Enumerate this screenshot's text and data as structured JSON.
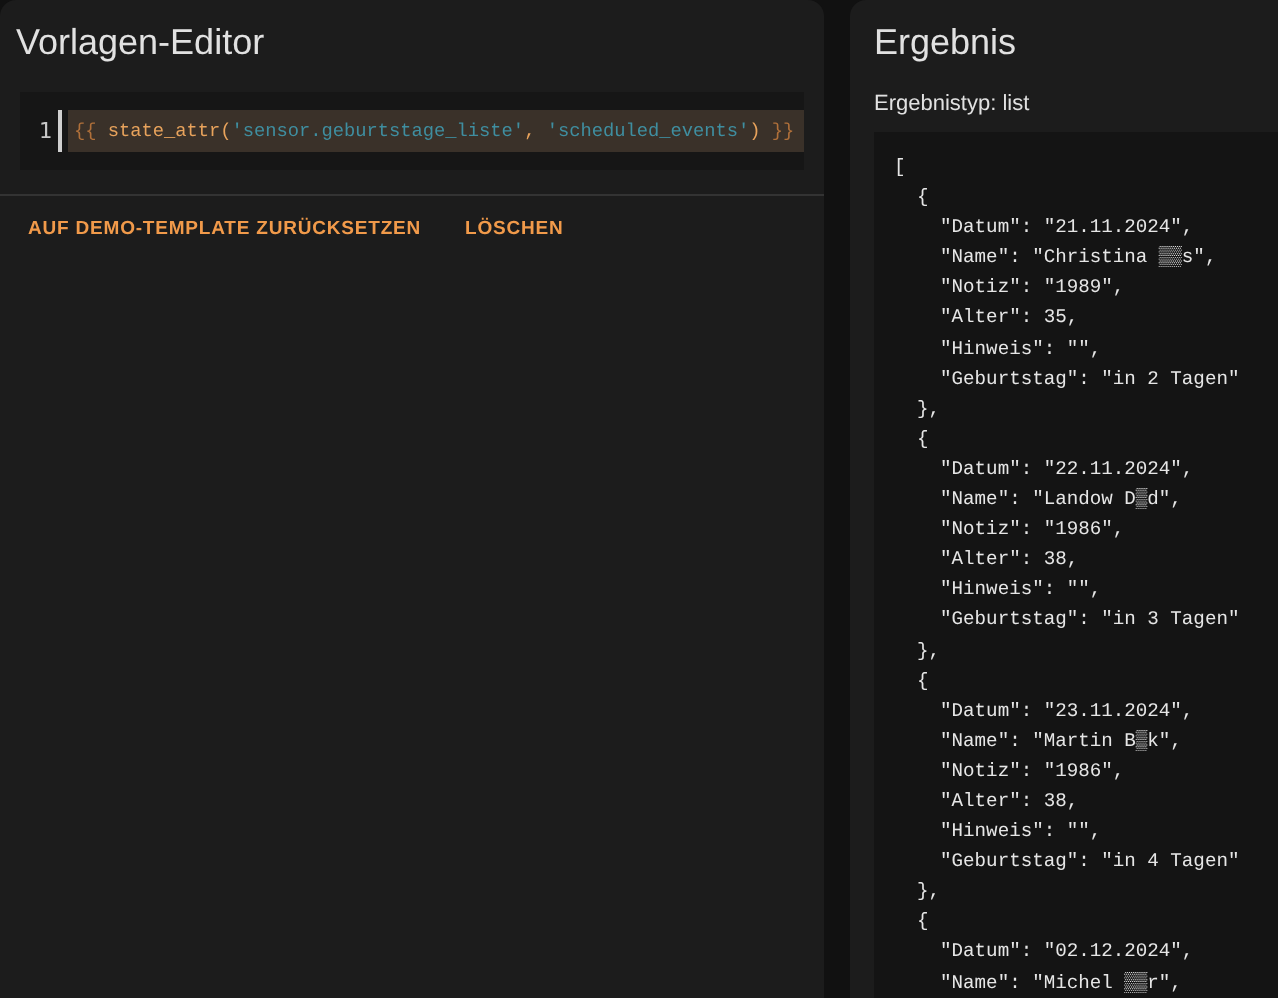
{
  "editor": {
    "title": "Vorlagen-Editor",
    "line_number": "1",
    "code_tokens": [
      {
        "kind": "brace",
        "text": "{{ "
      },
      {
        "kind": "func",
        "text": "state_attr("
      },
      {
        "kind": "string",
        "text": "'sensor.geburtstage_liste'"
      },
      {
        "kind": "func",
        "text": ", "
      },
      {
        "kind": "string",
        "text": "'scheduled_events'"
      },
      {
        "kind": "func",
        "text": ") "
      },
      {
        "kind": "brace",
        "text": "}}"
      }
    ],
    "buttons": [
      "AUF DEMO-TEMPLATE ZURÜCKSETZEN",
      "LÖSCHEN"
    ]
  },
  "result": {
    "title": "Ergebnis",
    "type_label": "Ergebnistyp: list",
    "lines": [
      "[",
      "  {",
      "    \"Datum\": \"21.11.2024\",",
      "    \"Name\": \"Christina ▒▒s\",",
      "    \"Notiz\": \"1989\",",
      "    \"Alter\": 35,",
      "    \"Hinweis\": \"\",",
      "    \"Geburtstag\": \"in 2 Tagen\"",
      "  },",
      "  {",
      "    \"Datum\": \"22.11.2024\",",
      "    \"Name\": \"Landow D▒d\",",
      "    \"Notiz\": \"1986\",",
      "    \"Alter\": 38,",
      "    \"Hinweis\": \"\",",
      "    \"Geburtstag\": \"in 3 Tagen\"",
      "  },",
      "  {",
      "    \"Datum\": \"23.11.2024\",",
      "    \"Name\": \"Martin B▒k\",",
      "    \"Notiz\": \"1986\",",
      "    \"Alter\": 38,",
      "    \"Hinweis\": \"\",",
      "    \"Geburtstag\": \"in 4 Tagen\"",
      "  },",
      "  {",
      "    \"Datum\": \"02.12.2024\",",
      "    \"Name\": \"Michel ▒▒r\","
    ]
  }
}
